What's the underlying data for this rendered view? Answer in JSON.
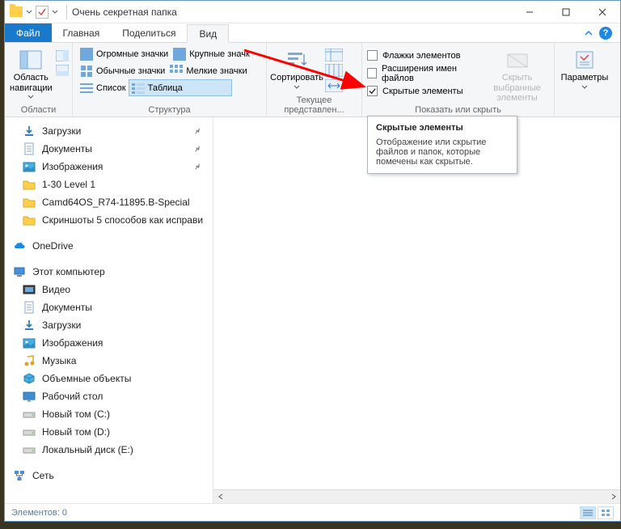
{
  "titlebar": {
    "title": "Очень секретная папка"
  },
  "window_controls": {
    "min": "–",
    "max": "□",
    "close": "✕"
  },
  "tabs": {
    "file": "Файл",
    "main": "Главная",
    "share": "Поделиться",
    "view": "Вид"
  },
  "ribbon": {
    "groups": {
      "areas": {
        "label": "Области",
        "nav_pane": "Область навигации"
      },
      "layout": {
        "label": "Структура",
        "items": {
          "xl": "Огромные значки",
          "lg": "Крупные значк",
          "md": "Обычные значки",
          "sm": "Мелкие значки",
          "list": "Список",
          "table": "Таблица"
        }
      },
      "current_view": {
        "label": "Текущее представлен...",
        "sort": "Сортировать"
      },
      "show_hide": {
        "label": "Показать или скрыть",
        "cb_item_flags": "Флажки элементов",
        "cb_ext": "Расширения имен файлов",
        "cb_hidden": "Скрытые элементы",
        "cb_hidden_checked": true,
        "hide_selected": "Скрыть выбранные элементы"
      },
      "options": {
        "label": "",
        "caption": "Параметры"
      }
    }
  },
  "tree": {
    "items": [
      {
        "icon": "download",
        "label": "Загрузки",
        "pinned": true,
        "indent": 1
      },
      {
        "icon": "doc",
        "label": "Документы",
        "pinned": true,
        "indent": 1
      },
      {
        "icon": "pictures",
        "label": "Изображения",
        "pinned": true,
        "indent": 1
      },
      {
        "icon": "folder",
        "label": "1-30 Level 1",
        "indent": 1
      },
      {
        "icon": "folder",
        "label": "Camd64OS_R74-11895.B-Special",
        "indent": 1
      },
      {
        "icon": "folder",
        "label": "Скриншоты 5 способов как исправи",
        "indent": 1
      },
      {
        "spacer": true
      },
      {
        "icon": "onedrive",
        "label": "OneDrive",
        "indent": 0
      },
      {
        "spacer": true
      },
      {
        "icon": "thispc",
        "label": "Этот компьютер",
        "indent": 0
      },
      {
        "icon": "video",
        "label": "Видео",
        "indent": 1
      },
      {
        "icon": "doc",
        "label": "Документы",
        "indent": 1
      },
      {
        "icon": "download",
        "label": "Загрузки",
        "indent": 1
      },
      {
        "icon": "pictures",
        "label": "Изображения",
        "indent": 1
      },
      {
        "icon": "music",
        "label": "Музыка",
        "indent": 1
      },
      {
        "icon": "objects3d",
        "label": "Объемные объекты",
        "indent": 1
      },
      {
        "icon": "desktop",
        "label": "Рабочий стол",
        "indent": 1
      },
      {
        "icon": "drive",
        "label": "Новый том (C:)",
        "indent": 1
      },
      {
        "icon": "drive",
        "label": "Новый том (D:)",
        "indent": 1
      },
      {
        "icon": "drive",
        "label": "Локальный диск (E:)",
        "indent": 1
      },
      {
        "spacer": true
      },
      {
        "icon": "network",
        "label": "Сеть",
        "indent": 0
      }
    ]
  },
  "tooltip": {
    "title": "Скрытые элементы",
    "body": "Отображение или скрытие файлов и папок, которые помечены как скрытые."
  },
  "status": {
    "items": "Элементов: 0"
  }
}
